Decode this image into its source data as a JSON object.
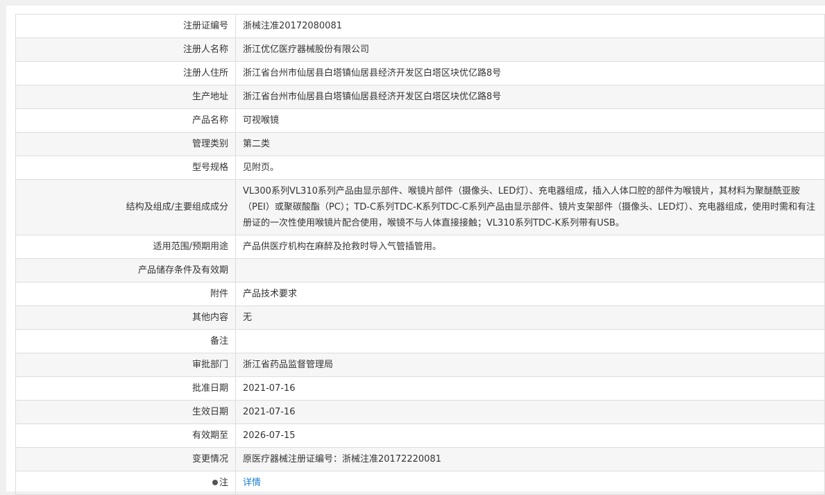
{
  "record": {
    "rows": [
      {
        "label": "注册证编号",
        "value": "浙械注准20172080081"
      },
      {
        "label": "注册人名称",
        "value": "浙江优亿医疗器械股份有限公司"
      },
      {
        "label": "注册人住所",
        "value": "浙江省台州市仙居县白塔镇仙居县经济开发区白塔区块优亿路8号"
      },
      {
        "label": "生产地址",
        "value": "浙江省台州市仙居县白塔镇仙居县经济开发区白塔区块优亿路8号"
      },
      {
        "label": "产品名称",
        "value": "可视喉镜"
      },
      {
        "label": "管理类别",
        "value": "第二类"
      },
      {
        "label": "型号规格",
        "value": "见附页。"
      },
      {
        "label": "结构及组成/主要组成成分",
        "value": "VL300系列VL310系列产品由显示部件、喉镜片部件（摄像头、LED灯）、充电器组成，插入人体口腔的部件为喉镜片，其材料为聚醚酰亚胺（PEI）或聚碳酸酯（PC）；TD-C系列TDC-K系列TDC-C系列产品由显示部件、镜片支架部件（摄像头、LED灯）、充电器组成，使用时需和有注册证的一次性使用喉镜片配合使用，喉镜不与人体直接接触；VL310系列TDC-K系列带有USB。"
      },
      {
        "label": "适用范围/预期用途",
        "value": "产品供医疗机构在麻醉及抢救时导入气管插管用。"
      },
      {
        "label": "产品储存条件及有效期",
        "value": ""
      },
      {
        "label": "附件",
        "value": "产品技术要求"
      },
      {
        "label": "其他内容",
        "value": "无"
      },
      {
        "label": "备注",
        "value": ""
      },
      {
        "label": "审批部门",
        "value": "浙江省药品监督管理局"
      },
      {
        "label": "批准日期",
        "value": "2021-07-16"
      },
      {
        "label": "生效日期",
        "value": "2021-07-16"
      },
      {
        "label": "有效期至",
        "value": "2026-07-15"
      },
      {
        "label": "变更情况",
        "value": "原医疗器械注册证编号：浙械注准20172220081"
      }
    ],
    "note": {
      "label": "注",
      "icon": "bullet-icon",
      "link_text": "详情"
    }
  }
}
